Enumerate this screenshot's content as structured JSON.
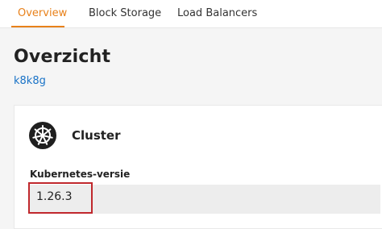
{
  "tabs": [
    {
      "label": "Overview",
      "active": true
    },
    {
      "label": "Block Storage",
      "active": false
    },
    {
      "label": "Load Balancers",
      "active": false
    }
  ],
  "page": {
    "title": "Overzicht",
    "project_link": "k8k8g"
  },
  "cluster_card": {
    "icon": "kubernetes-helm-icon",
    "title": "Cluster",
    "version_label": "Kubernetes-versie",
    "version_value": "1.26.3"
  },
  "colors": {
    "accent": "#e8811a",
    "link": "#1a73c7",
    "highlight": "#c0282d"
  }
}
